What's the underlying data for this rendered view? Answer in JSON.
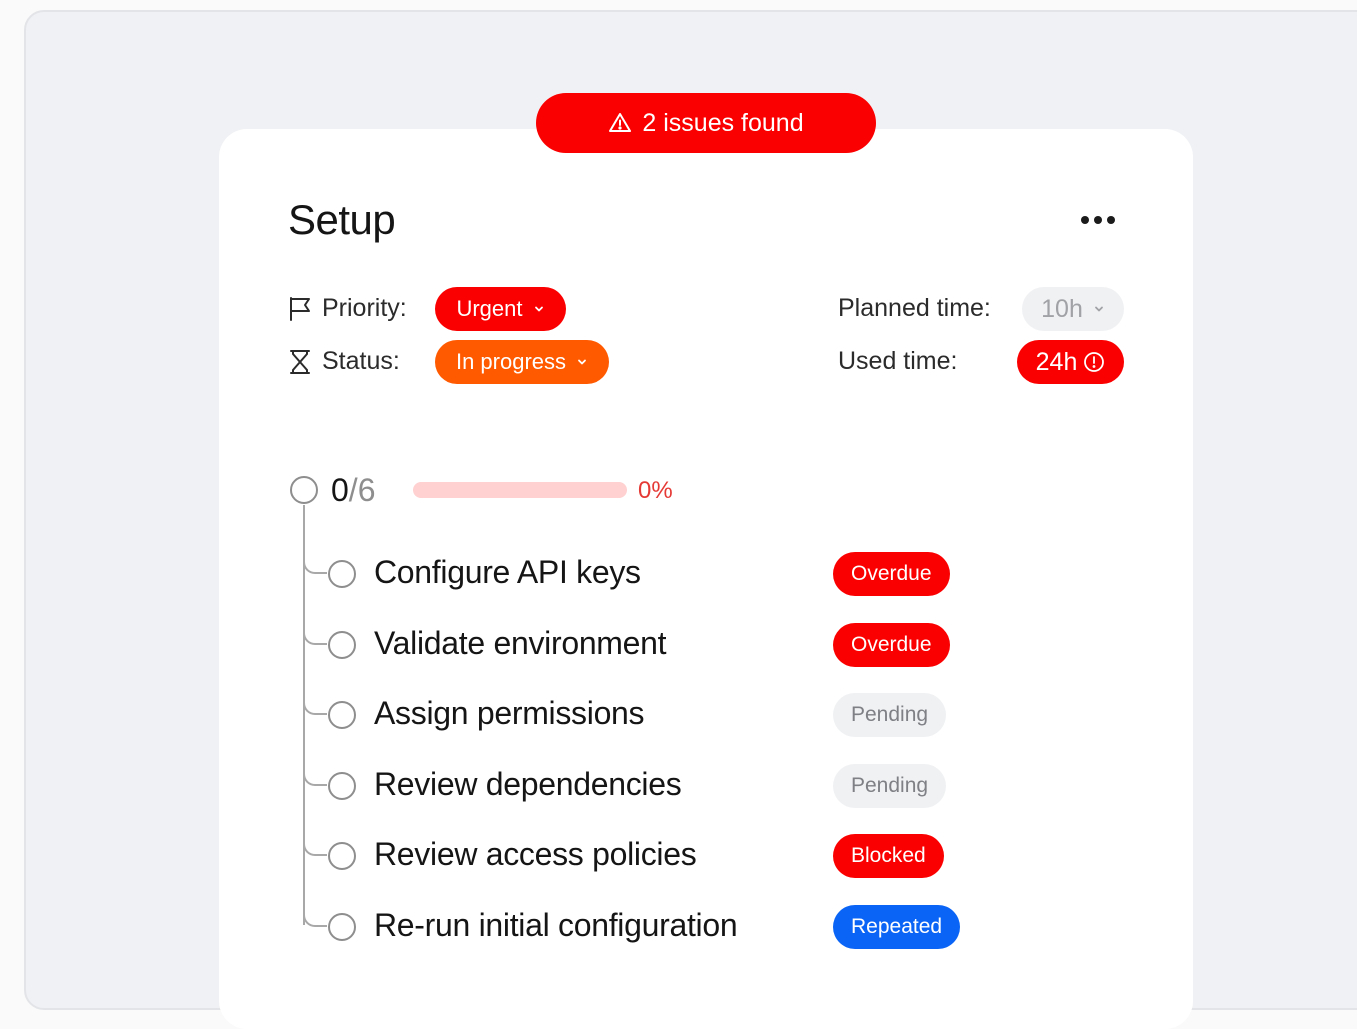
{
  "banner": {
    "text": "2 issues found",
    "icon": "warning-triangle-icon"
  },
  "card": {
    "title": "Setup",
    "more_icon": "more-horizontal-icon"
  },
  "meta": {
    "priority": {
      "label": "Priority:",
      "value": "Urgent",
      "icon": "flag-icon"
    },
    "status": {
      "label": "Status:",
      "value": "In progress",
      "icon": "hourglass-icon"
    },
    "planned_time": {
      "label": "Planned time:",
      "value": "10h"
    },
    "used_time": {
      "label": "Used time:",
      "value": "24h",
      "icon": "alert-circle-icon"
    }
  },
  "progress": {
    "done": "0",
    "total": "/6",
    "percent_label": "0%",
    "fraction": 0
  },
  "tasks": [
    {
      "label": "Configure API keys",
      "badge": "Overdue",
      "badge_type": "red"
    },
    {
      "label": "Validate environment",
      "badge": "Overdue",
      "badge_type": "red"
    },
    {
      "label": "Assign permissions",
      "badge": "Pending",
      "badge_type": "gray"
    },
    {
      "label": "Review dependencies",
      "badge": "Pending",
      "badge_type": "gray"
    },
    {
      "label": "Review access policies",
      "badge": "Blocked",
      "badge_type": "red"
    },
    {
      "label": "Re-run initial configuration",
      "badge": "Repeated",
      "badge_type": "blue"
    }
  ],
  "colors": {
    "danger": "#fb0000",
    "warning": "#ff5a00",
    "info": "#0a64f5",
    "muted": "#f0f1f3"
  }
}
